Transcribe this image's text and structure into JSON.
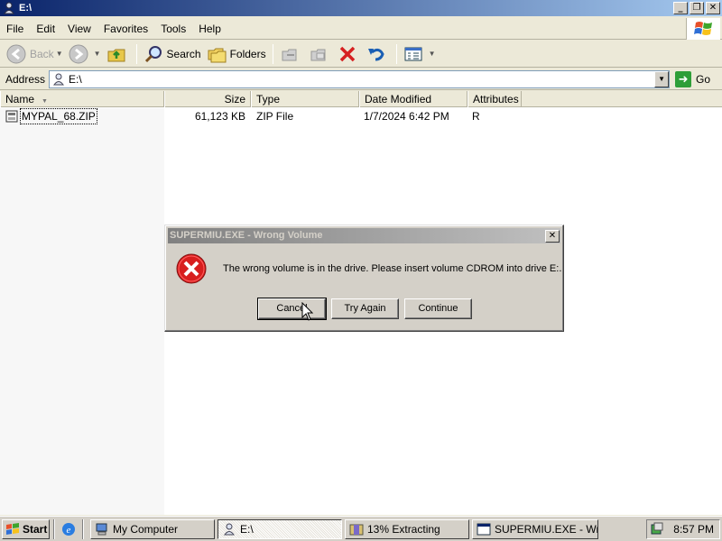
{
  "window": {
    "title": "E:\\"
  },
  "menu": {
    "items": [
      {
        "label": "File",
        "key": "F"
      },
      {
        "label": "Edit",
        "key": "E"
      },
      {
        "label": "View",
        "key": "V"
      },
      {
        "label": "Favorites",
        "key": "a"
      },
      {
        "label": "Tools",
        "key": "T"
      },
      {
        "label": "Help",
        "key": "H"
      }
    ]
  },
  "toolbar": {
    "back_label": "Back",
    "search_label": "Search",
    "folders_label": "Folders"
  },
  "address": {
    "label": "Address",
    "value": "E:\\",
    "go_label": "Go"
  },
  "columns": {
    "name": "Name",
    "size": "Size",
    "type": "Type",
    "date": "Date Modified",
    "attributes": "Attributes"
  },
  "files": [
    {
      "name": "MYPAL_68.ZIP",
      "size": "61,123 KB",
      "type": "ZIP File",
      "date": "1/7/2024 6:42 PM",
      "attributes": "R"
    }
  ],
  "dialog": {
    "title": "SUPERMIU.EXE - Wrong Volume",
    "message": "The wrong volume is in the drive. Please insert volume CDROM into drive E:.",
    "buttons": {
      "cancel": "Cancel",
      "try_again": "Try Again",
      "continue": "Continue"
    }
  },
  "taskbar": {
    "start_label": "Start",
    "tasks": [
      {
        "label": "My Computer"
      },
      {
        "label": "E:\\"
      },
      {
        "label": "13% Extracting"
      },
      {
        "label": "SUPERMIU.EXE - Wr..."
      }
    ],
    "clock": "8:57 PM"
  }
}
